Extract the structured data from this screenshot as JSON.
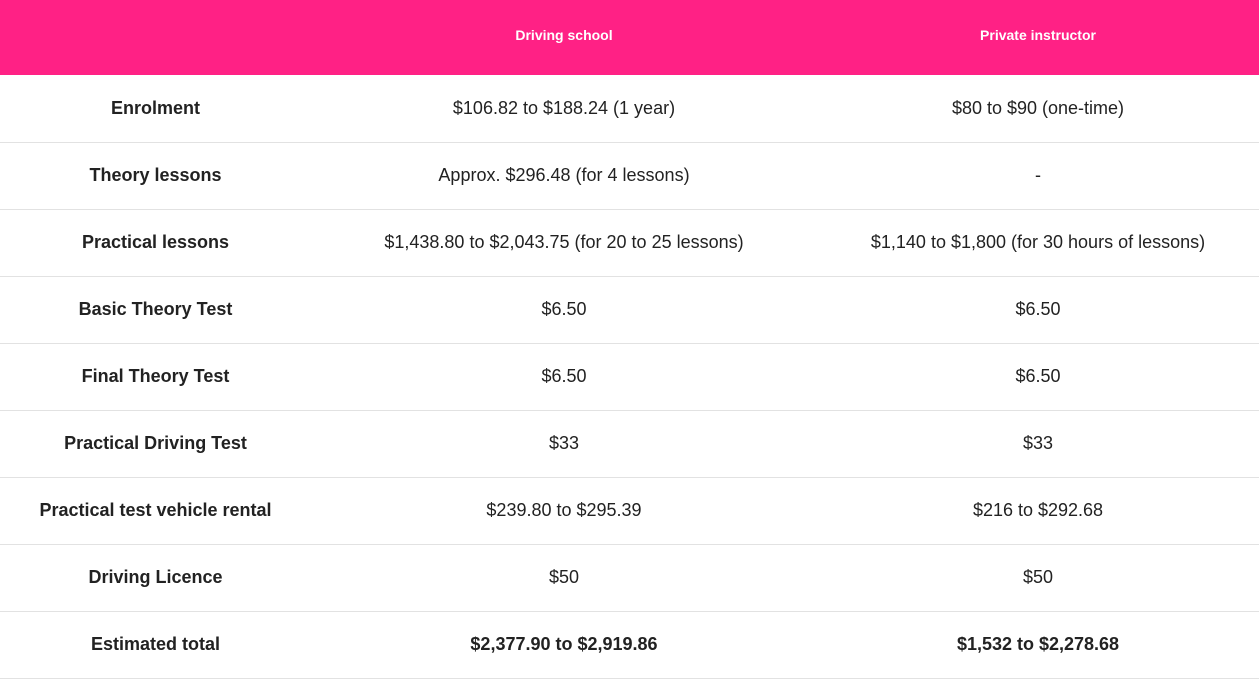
{
  "table": {
    "headers": [
      "",
      "Driving school",
      "Private instructor"
    ],
    "rows": [
      {
        "label": "Enrolment",
        "driving_school": "$106.82 to $188.24 (1 year)",
        "private_instructor": "$80 to $90 (one-time)"
      },
      {
        "label": "Theory lessons",
        "driving_school": "Approx. $296.48 (for 4 lessons)",
        "private_instructor": "-"
      },
      {
        "label": "Practical lessons",
        "driving_school": "$1,438.80 to $2,043.75 (for 20 to 25 lessons)",
        "private_instructor": "$1,140 to $1,800 (for 30 hours of lessons)"
      },
      {
        "label": "Basic Theory Test",
        "driving_school": "$6.50",
        "private_instructor": "$6.50"
      },
      {
        "label": "Final Theory Test",
        "driving_school": "$6.50",
        "private_instructor": "$6.50"
      },
      {
        "label": "Practical Driving Test",
        "driving_school": "$33",
        "private_instructor": "$33"
      },
      {
        "label": "Practical test vehicle rental",
        "driving_school": "$239.80 to $295.39",
        "private_instructor": "$216 to $292.68"
      },
      {
        "label": "Driving Licence",
        "driving_school": "$50",
        "private_instructor": "$50"
      },
      {
        "label": "Estimated total",
        "driving_school": "$2,377.90 to $2,919.86",
        "private_instructor": "$1,532 to $2,278.68"
      }
    ]
  },
  "colors": {
    "header_bg": "#ff2185",
    "header_text": "#ffffff",
    "body_text": "#222222",
    "row_divider": "#e2e2e2"
  }
}
